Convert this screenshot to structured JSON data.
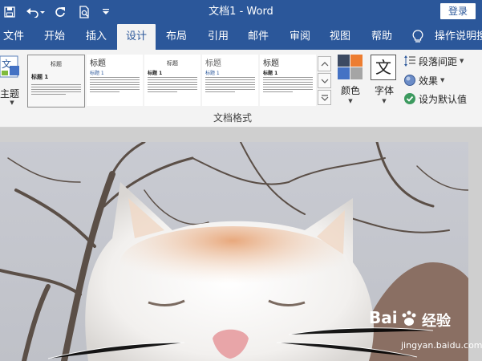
{
  "window": {
    "title": "文档1  -  Word",
    "login_label": "登录"
  },
  "quick_access": [
    {
      "name": "save-icon"
    },
    {
      "name": "undo-icon"
    },
    {
      "name": "redo-icon"
    },
    {
      "name": "print-preview-icon"
    },
    {
      "name": "customize-qat-icon"
    }
  ],
  "tabs": [
    {
      "label": "文件",
      "active": false
    },
    {
      "label": "开始",
      "active": false
    },
    {
      "label": "插入",
      "active": false
    },
    {
      "label": "设计",
      "active": true
    },
    {
      "label": "布局",
      "active": false
    },
    {
      "label": "引用",
      "active": false
    },
    {
      "label": "邮件",
      "active": false
    },
    {
      "label": "审阅",
      "active": false
    },
    {
      "label": "视图",
      "active": false
    },
    {
      "label": "帮助",
      "active": false
    }
  ],
  "tell_me": "操作说明搜",
  "ribbon": {
    "theme_label": "主题",
    "theme_glyph": "文",
    "styles": [
      {
        "title": "标题",
        "heading": "标题 1",
        "selected": true
      },
      {
        "title": "标题",
        "heading": "标题 1",
        "selected": false
      },
      {
        "title": "标题",
        "heading": "标题 1",
        "selected": false
      },
      {
        "title": "标题",
        "heading": "标题 1",
        "selected": false
      },
      {
        "title": "标题",
        "heading": "标题 1",
        "selected": false
      }
    ],
    "colors_label": "颜色",
    "font_label": "字体",
    "font_glyph": "文",
    "paragraph_spacing_label": "段落间距",
    "effects_label": "效果",
    "set_default_label": "设为默认值",
    "group_label": "文档格式"
  },
  "colors": {
    "brand": "#2b579a",
    "swatch_top_left": "#3c4a62",
    "swatch_top_right": "#ed7d31",
    "swatch_bottom_left": "#4472c4",
    "swatch_bottom_right": "#a5a5a5",
    "check_green": "#3c9a5f"
  },
  "watermark": {
    "text": "Bai",
    "suffix": "经验",
    "url": "jingyan.baidu.com"
  }
}
